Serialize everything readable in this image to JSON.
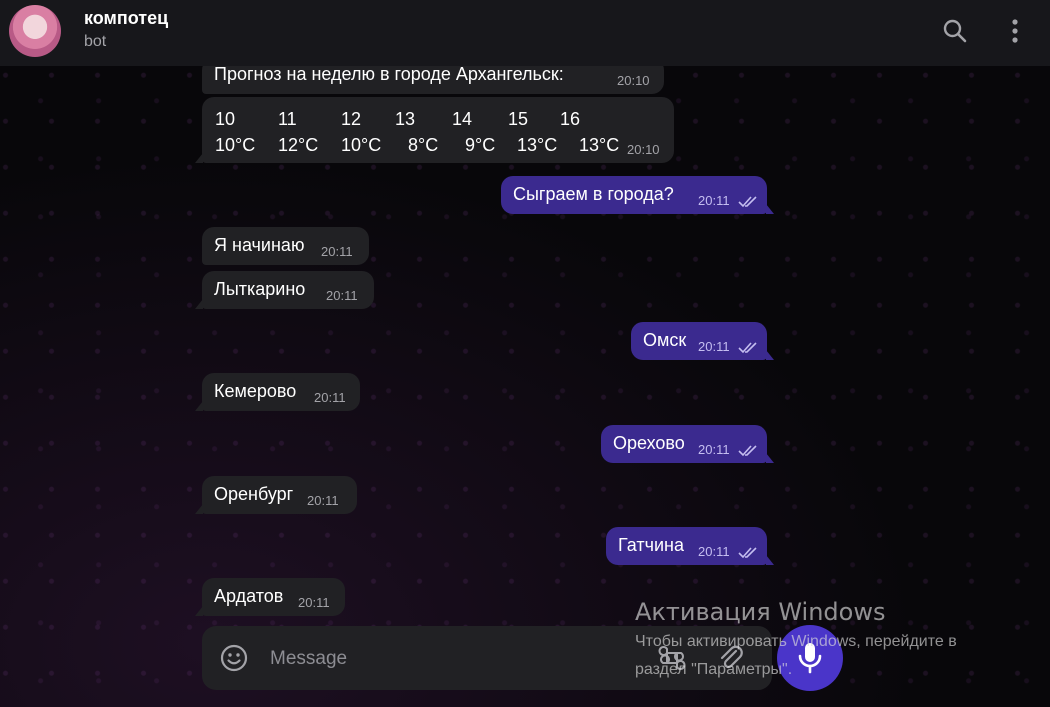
{
  "header": {
    "title": "компотец",
    "subtitle": "bot",
    "search_icon": "search-icon",
    "more_icon": "more-vertical-icon"
  },
  "messages": [
    {
      "dir": "in",
      "text": "Прогноз на неделю в городе Архангельск:",
      "time": "20:10"
    },
    {
      "dir": "in",
      "type": "forecast",
      "days": [
        "10",
        "11",
        "12",
        "13",
        "14",
        "15",
        "16"
      ],
      "temps": [
        "10°C",
        "12°C",
        "10°C",
        "8°C",
        "9°C",
        "13°C",
        "13°C"
      ],
      "time": "20:10"
    },
    {
      "dir": "out",
      "text": "Сыграем в города?",
      "time": "20:11",
      "read": true
    },
    {
      "dir": "in",
      "text": "Я начинаю",
      "time": "20:11"
    },
    {
      "dir": "in",
      "text": "Лыткарино",
      "time": "20:11"
    },
    {
      "dir": "out",
      "text": "Омск",
      "time": "20:11",
      "read": true
    },
    {
      "dir": "in",
      "text": "Кемерово",
      "time": "20:11"
    },
    {
      "dir": "out",
      "text": "Орехово",
      "time": "20:11",
      "read": true
    },
    {
      "dir": "in",
      "text": "Оренбург",
      "time": "20:11"
    },
    {
      "dir": "out",
      "text": "Гатчина",
      "time": "20:11",
      "read": true
    },
    {
      "dir": "in",
      "text": "Ардатов",
      "time": "20:11"
    }
  ],
  "composer": {
    "placeholder": "Message",
    "emoji_icon": "emoji-icon",
    "commands_icon": "command-icon",
    "attach_icon": "paperclip-icon",
    "mic_icon": "microphone-icon"
  },
  "watermark": {
    "title": "Активация Windows",
    "line1": "Чтобы активировать Windows, перейдите в",
    "line2": "раздел \"Параметры\"."
  },
  "colors": {
    "header_bg": "#17171b",
    "incoming_bubble": "#212124",
    "outgoing_bubble": "#3b2a8f",
    "accent": "#4a35c9"
  }
}
